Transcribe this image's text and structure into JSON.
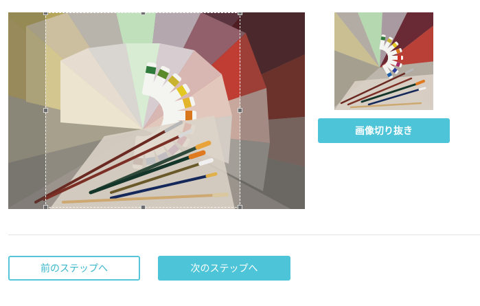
{
  "crop_section": {
    "image_subject": "paint tubes arranged in a fan on color swatches with paintbrushes",
    "preview_label": "cropped-preview",
    "crop_button_label": "画像切り抜き"
  },
  "navigation": {
    "prev_button_label": "前のステップへ",
    "next_button_label": "次のステップへ"
  },
  "colors": {
    "accent": "#4dc4d8",
    "accent_border": "#55c6d9"
  }
}
